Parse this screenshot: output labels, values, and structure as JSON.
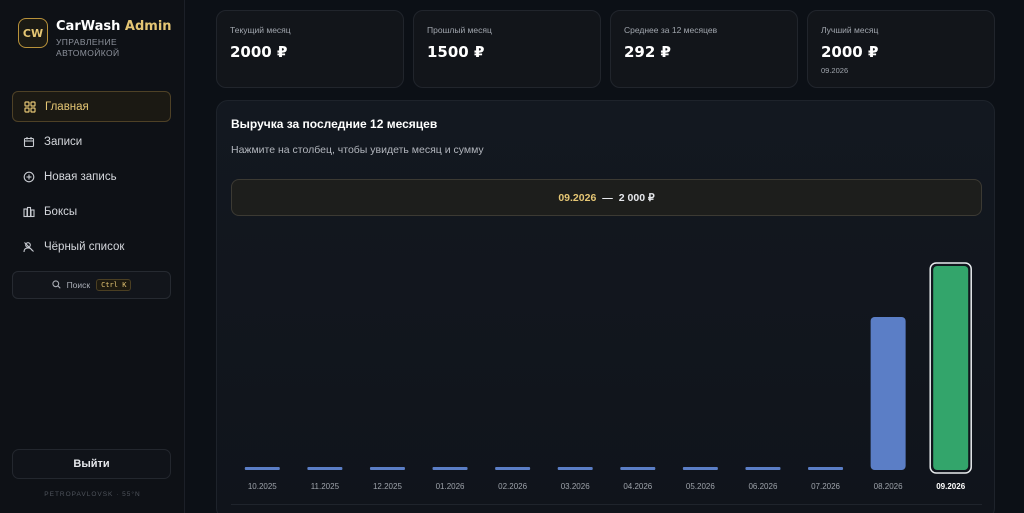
{
  "brand": {
    "logo": "CW",
    "name_main": "CarWash",
    "name_accent": "Admin",
    "subtitle": "Управление автомойкой"
  },
  "nav": [
    {
      "label": "Главная",
      "icon": "grid-icon",
      "active": true
    },
    {
      "label": "Записи",
      "icon": "calendar-icon",
      "active": false
    },
    {
      "label": "Новая запись",
      "icon": "plus-circle-icon",
      "active": false
    },
    {
      "label": "Боксы",
      "icon": "boxes-icon",
      "active": false
    },
    {
      "label": "Чёрный список",
      "icon": "user-block-icon",
      "active": false
    }
  ],
  "search": {
    "label": "Поиск",
    "shortcut": "Ctrl K",
    "icon": "search-icon"
  },
  "logout_label": "Выйти",
  "footer": "PETROPAVLOVSK · 55°N",
  "stats": [
    {
      "label": "Текущий месяц",
      "value": "2000 ₽"
    },
    {
      "label": "Прошлый месяц",
      "value": "1500 ₽"
    },
    {
      "label": "Среднее за 12 месяцев",
      "value": "292 ₽"
    },
    {
      "label": "Лучший месяц",
      "value": "2000 ₽",
      "sub": "09.2026"
    }
  ],
  "chart": {
    "title": "Выручка за последние 12 месяцев",
    "hint": "Нажмите на столбец, чтобы увидеть месяц и сумму",
    "selected_month": "09.2026",
    "separator": "—",
    "selected_value": "2 000 ₽"
  },
  "chart_data": {
    "type": "bar",
    "categories": [
      "10.2025",
      "11.2025",
      "12.2025",
      "01.2026",
      "02.2026",
      "03.2026",
      "04.2026",
      "05.2026",
      "06.2026",
      "07.2026",
      "08.2026",
      "09.2026"
    ],
    "values": [
      0,
      0,
      0,
      0,
      0,
      0,
      0,
      0,
      0,
      0,
      1500,
      2000
    ],
    "ylim": [
      0,
      2000
    ],
    "selected_index": 11,
    "bar_color": "#5b7ec6",
    "selected_color": "#33a56b",
    "grid": false
  },
  "colors": {
    "accent": "#e5c674",
    "background": "#0c1016"
  }
}
